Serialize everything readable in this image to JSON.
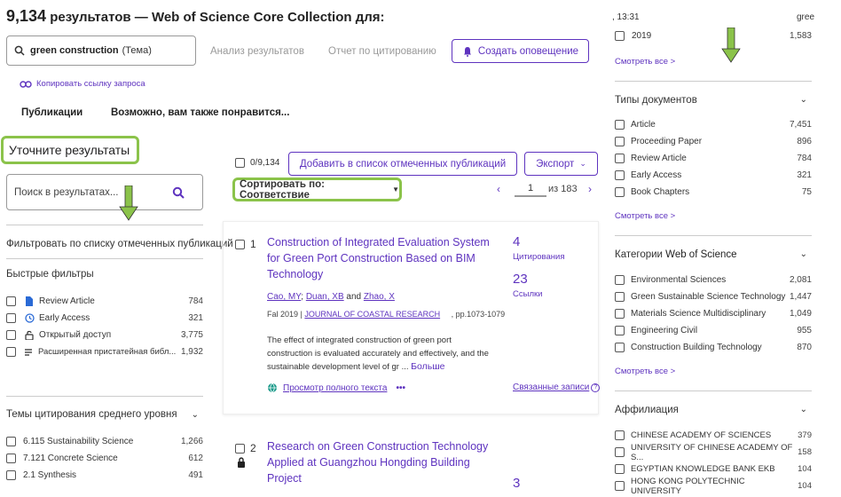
{
  "header": {
    "count": "9,134",
    "title_rest": "результатов — Web of Science Core Collection для:",
    "query": "green construction",
    "query_field": "(Тема)",
    "analyze": "Анализ результатов",
    "citation_report": "Отчет по цитированию",
    "create_alert": "Создать оповещение",
    "copy_link": "Копировать ссылку запроса"
  },
  "tabs": [
    "Публикации",
    "Возможно, вам также понравится..."
  ],
  "left": {
    "refine_title": "Уточните результаты",
    "search_placeholder": "Поиск в результатах...",
    "filter_marked": "Фильтровать по списку отмеченных публикаций",
    "quick_filters_title": "Быстрые фильтры",
    "quick_filters": [
      {
        "label": "Review Article",
        "count": "784",
        "icon": "document-icon"
      },
      {
        "label": "Early Access",
        "count": "321",
        "icon": "clock-icon"
      },
      {
        "label": "Открытый доступ",
        "count": "3,775",
        "icon": "unlock-icon"
      },
      {
        "label": "Расширенная пристатейная библ...",
        "count": "1,932",
        "icon": "list-icon"
      }
    ],
    "citation_topics_title": "Темы цитирования среднего уровня",
    "citation_topics": [
      {
        "label": "6.115 Sustainability Science",
        "count": "1,266"
      },
      {
        "label": "7.121 Concrete Science",
        "count": "612"
      },
      {
        "label": "2.1 Synthesis",
        "count": "491"
      }
    ]
  },
  "middle": {
    "selected": "0/9,134",
    "add_to_marked": "Добавить в список отмеченных публикаций",
    "export": "Экспорт",
    "sort": "Сортировать по: Соответствие",
    "page": "1",
    "of_pages": "из 183",
    "results": [
      {
        "num": "1",
        "title": [
          "Construction of Integrated Evaluation System",
          "for Green Port Construction Based on BIM",
          "Technology"
        ],
        "authors": [
          "Cao, MY",
          "Duan, XB",
          "Zhao, X"
        ],
        "and": "and",
        "date": "Fal 2019 |",
        "journal": "JOURNAL OF COASTAL RESEARCH",
        "pages": ", pp.1073-1079",
        "abstract": [
          "The effect of integrated construction of green port",
          "construction is evaluated accurately and effectively, and the",
          "sustainable development level of gr ..."
        ],
        "more": "Больше",
        "fulltext": "Просмотр полного текста",
        "citations": "4",
        "citations_label": "Цитирования",
        "refs": "23",
        "refs_label": "Ссылки",
        "related": "Связанные записи"
      },
      {
        "num": "2",
        "title": [
          "Research on Green Construction Technology",
          "Applied at Guangzhou Hongding Building",
          "Project"
        ],
        "citations": "3"
      }
    ]
  },
  "right": {
    "top_time": ", 13:31",
    "top_green": "gree",
    "year_row": {
      "label": "2019",
      "count": "1,583"
    },
    "see_all": "Смотреть все >",
    "doc_types_title": "Типы документов",
    "doc_types": [
      {
        "label": "Article",
        "count": "7,451"
      },
      {
        "label": "Proceeding Paper",
        "count": "896"
      },
      {
        "label": "Review Article",
        "count": "784"
      },
      {
        "label": "Early Access",
        "count": "321"
      },
      {
        "label": "Book Chapters",
        "count": "75"
      }
    ],
    "wos_title_prefix": "Категории",
    "wos_title_main": "Web of Science",
    "wos_categories": [
      {
        "label": "Environmental Sciences",
        "count": "2,081"
      },
      {
        "label": "Green Sustainable Science Technology",
        "count": "1,447"
      },
      {
        "label": "Materials Science Multidisciplinary",
        "count": "1,049"
      },
      {
        "label": "Engineering Civil",
        "count": "955"
      },
      {
        "label": "Construction Building Technology",
        "count": "870"
      }
    ],
    "affiliation_title": "Аффилиация",
    "affiliations": [
      {
        "label": "CHINESE ACADEMY OF SCIENCES",
        "count": "379"
      },
      {
        "label": "UNIVERSITY OF CHINESE ACADEMY OF S...",
        "count": "158"
      },
      {
        "label": "EGYPTIAN KNOWLEDGE BANK EKB",
        "count": "104"
      },
      {
        "label": "HONG KONG POLYTECHNIC UNIVERSITY",
        "count": "104"
      }
    ]
  }
}
